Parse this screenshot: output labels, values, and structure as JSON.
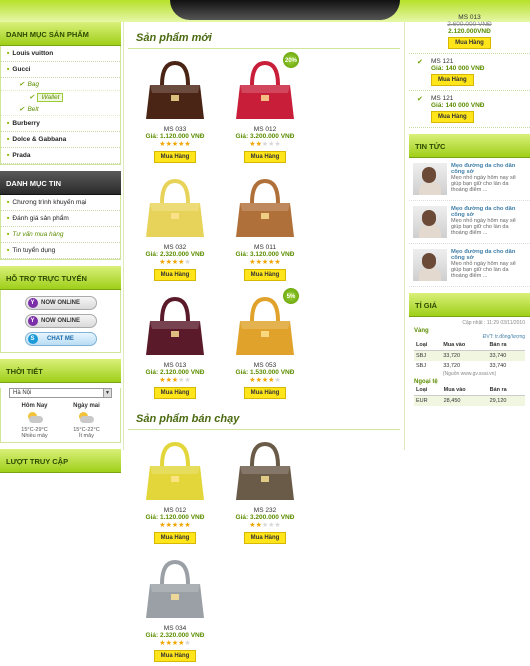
{
  "left": {
    "categories_title": "DANH MỤC SẢN PHẨM",
    "categories": [
      {
        "label": "Louis vuitton"
      },
      {
        "label": "Gucci"
      }
    ],
    "gucci_sub": {
      "bag": "Bag",
      "wallet": "Wallet",
      "belt": "Belt"
    },
    "categories_more": [
      {
        "label": "Burberry"
      },
      {
        "label": "Dolce & Gabbana"
      },
      {
        "label": "Prada"
      }
    ],
    "news_title": "DANH MỤC TIN",
    "news_items": [
      {
        "label": "Chương trình khuyến mại"
      },
      {
        "label": "Đánh giá sản phẩm"
      },
      {
        "label": "Tư vấn mua hàng"
      },
      {
        "label": "Tin tuyển dụng"
      }
    ],
    "support_title": "HỖ TRỢ TRỰC TUYẾN",
    "support": [
      "NOW ONLINE",
      "NOW ONLINE",
      "CHAT ME"
    ],
    "skype_label": "skype",
    "weather_title": "THỜI TIẾT",
    "city": "Hà Nội",
    "today": {
      "day": "Hôm Nay",
      "temp": "15°C-29°C",
      "desc": "Nhiều mây"
    },
    "tomorrow": {
      "day": "Ngày mai",
      "temp": "15°C-22°C",
      "desc": "Ít mây"
    },
    "visits_title": "LƯỢT TRUY CẬP"
  },
  "center": {
    "new_title": "Sản phẩm mới",
    "hot_title": "Sản phẩm bán chạy",
    "buy_label": "Mua Hàng",
    "new_products": [
      {
        "code": "MS 033",
        "price": "1.120.000 VNĐ",
        "stars": 5,
        "badge": "",
        "color": "#4a2414"
      },
      {
        "code": "MS 012",
        "price": "3.200.000 VNĐ",
        "stars": 2,
        "badge": "20%",
        "color": "#c81e3a"
      },
      {
        "code": "MS 032",
        "price": "2.320.000 VNĐ",
        "stars": 4,
        "badge": "",
        "color": "#e8d35a"
      },
      {
        "code": "MS 011",
        "price": "3.120.000 VNĐ",
        "stars": 5,
        "badge": "",
        "color": "#b0703a"
      },
      {
        "code": "MS 013",
        "price": "2.120.000 VNĐ",
        "stars": 3,
        "badge": "",
        "color": "#5a1a2a"
      },
      {
        "code": "MS 053",
        "price": "1.530.000 VNĐ",
        "stars": 4,
        "badge": "5%",
        "color": "#e0a22a"
      }
    ],
    "hot_products": [
      {
        "code": "MS 012",
        "price": "1.120.000 VNĐ",
        "stars": 5,
        "color": "#e2d63a"
      },
      {
        "code": "MS 232",
        "price": "3.200.000 VNĐ",
        "stars": 2,
        "color": "#6a5a48"
      },
      {
        "code": "MS 034",
        "price": "2.320.000 VNĐ",
        "stars": 4,
        "color": "#9aa0a6"
      }
    ]
  },
  "right": {
    "top_item": {
      "code": "MS 013",
      "old": "2.600.000 VNĐ",
      "price": "2.120.000VNĐ"
    },
    "items": [
      {
        "code": "MS 121",
        "price": "Giá: 140 000 VNĐ"
      },
      {
        "code": "MS 121",
        "price": "Giá: 140 000 VNĐ"
      }
    ],
    "news_title": "TIN TỨC",
    "news": [
      {
        "title": "Mẹo đường da cho dân công sở",
        "desc": "Mẹo nhỏ ngày hôm nay sẽ giúp bạn giữ cho làn da thoáng điểm ..."
      },
      {
        "title": "Mẹo đường da cho dân công sở",
        "desc": "Mẹo nhỏ ngày hôm nay sẽ giúp bạn giữ cho làn da thoáng điểm ..."
      },
      {
        "title": "Mẹo đường da cho dân công sở",
        "desc": "Mẹo nhỏ ngày hôm nay sẽ giúp bạn giữ cho làn da thoáng điểm ..."
      }
    ],
    "rate_title": "TỈ GIÁ",
    "rate_updated": "Cập nhật : 11:29 03/11/2010",
    "gold_label": "Vàng",
    "gold_unit": "ĐVT: tr.đồng/lượng",
    "gold_cols": [
      "Loại",
      "Mua vào",
      "Bán ra"
    ],
    "gold_rows": [
      [
        "SBJ",
        "33,720",
        "33,740"
      ],
      [
        "SBJ",
        "33,720",
        "33,740"
      ]
    ],
    "gold_source": "(Nguồn www.gv.ssai.vn)",
    "fx_label": "Ngoại tệ",
    "fx_cols": [
      "Loại",
      "Mua vào",
      "Bán ra"
    ],
    "fx_rows": [
      [
        "EUR",
        "28,450",
        "29,120"
      ]
    ]
  }
}
